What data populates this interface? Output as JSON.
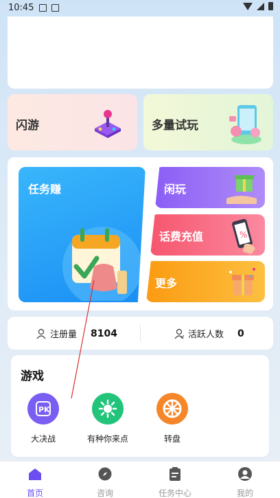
{
  "status_bar": {
    "time": "10:45"
  },
  "cards": {
    "flash": {
      "label": "闪游"
    },
    "trial": {
      "label": "多量试玩"
    },
    "task_earn": {
      "label": "任务赚"
    },
    "idle_play": {
      "label": "闲玩"
    },
    "phone_recharge": {
      "label": "话费充值"
    },
    "more": {
      "label": "更多"
    }
  },
  "stats": {
    "registered_label": "注册量",
    "registered_value": "8104",
    "active_label": "活跃人数",
    "active_value": "0"
  },
  "games": {
    "title": "游戏",
    "items": [
      {
        "name": "大决战",
        "icon": "pk-icon",
        "color": "#7a5ef2"
      },
      {
        "name": "有种你来点",
        "icon": "target-icon",
        "color": "#22c47a"
      },
      {
        "name": "转盘",
        "icon": "wheel-icon",
        "color": "#f5862a"
      }
    ]
  },
  "tabbar": {
    "items": [
      {
        "label": "首页",
        "icon": "home-icon"
      },
      {
        "label": "咨询",
        "icon": "compass-icon"
      },
      {
        "label": "任务中心",
        "icon": "clipboard-icon"
      },
      {
        "label": "我的",
        "icon": "profile-icon"
      }
    ]
  },
  "colors": {
    "accent": "#6b4df0"
  }
}
